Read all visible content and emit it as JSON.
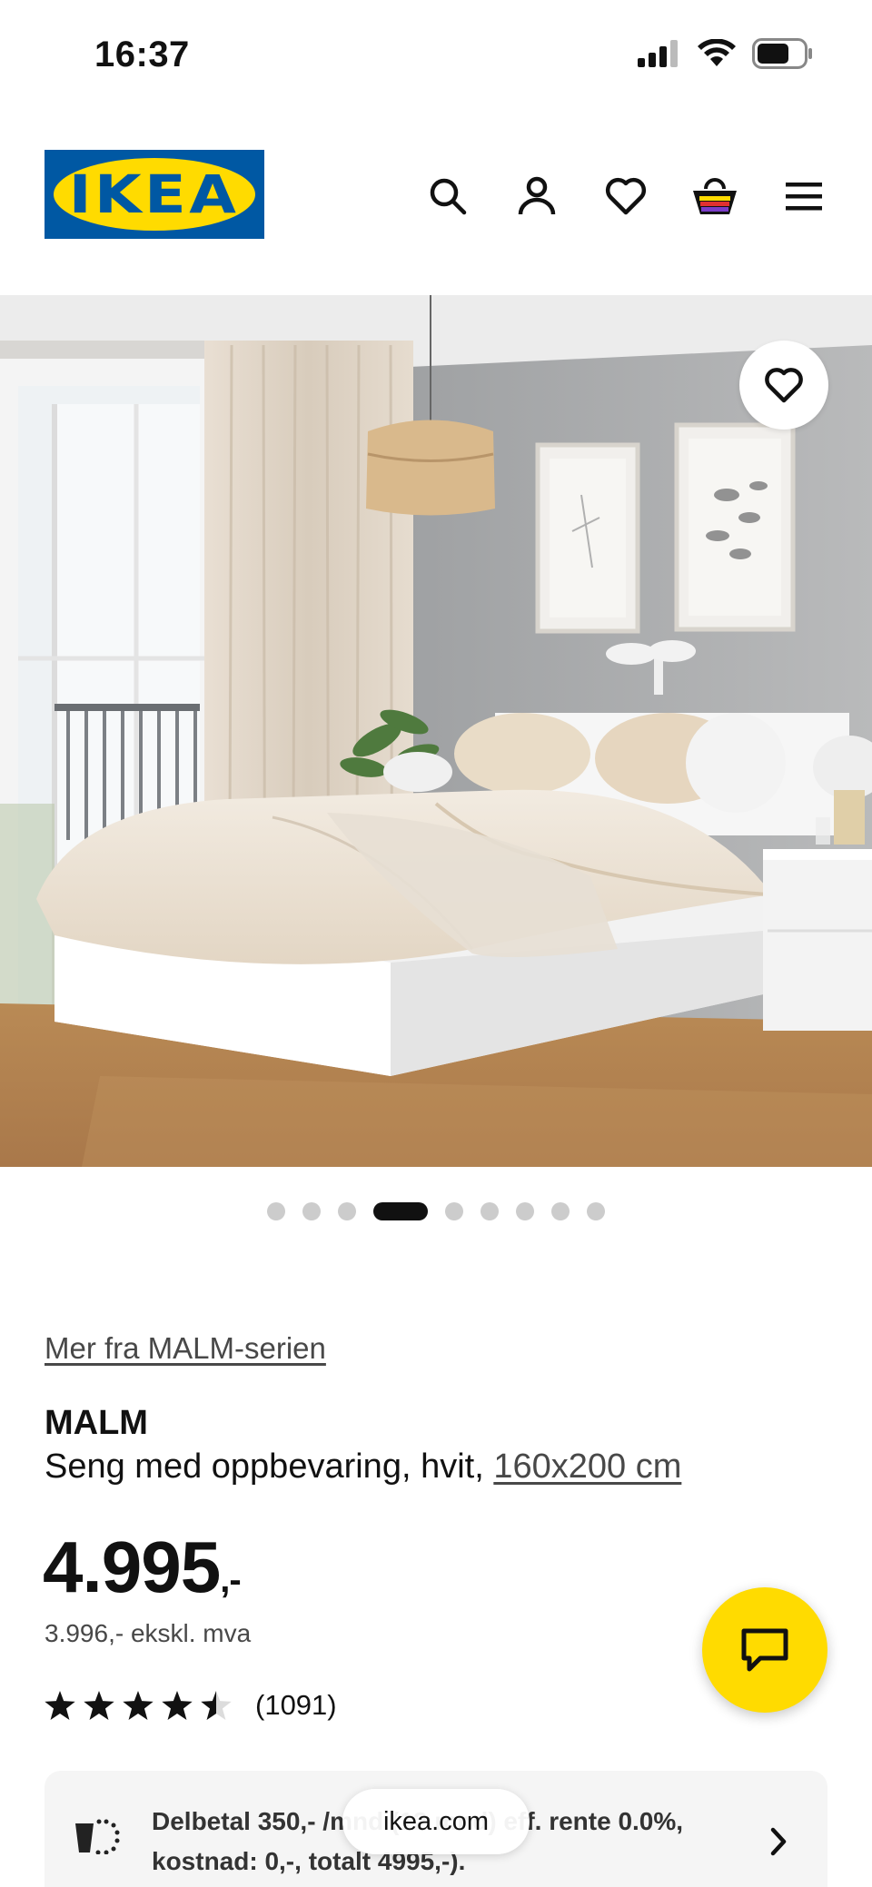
{
  "status_bar": {
    "time": "16:37"
  },
  "header": {
    "logo_text": "IKEA",
    "icons": [
      "search-icon",
      "account-icon",
      "wishlist-heart-icon",
      "shopping-basket-icon",
      "menu-icon"
    ]
  },
  "gallery": {
    "total_images": 9,
    "active_index": 4
  },
  "product": {
    "series_link": "Mer fra MALM-serien",
    "name": "MALM",
    "description": "Seng med oppbevaring, hvit, ",
    "size_link": "160x200 cm",
    "price": "4.995",
    "price_suffix": ",-",
    "price_ex_vat": "3.996,- ekskl. mva",
    "rating": 4.5,
    "review_count": "(1091)"
  },
  "financing": {
    "text": "Delbetal 350,- /mnd (12 mnd) eff. rente 0.0%, kostnad: 0,-, totalt 4995,-)."
  },
  "browser": {
    "url": "ikea.com"
  },
  "colors": {
    "ikea_blue": "#0058a3",
    "ikea_yellow": "#ffdb00"
  }
}
